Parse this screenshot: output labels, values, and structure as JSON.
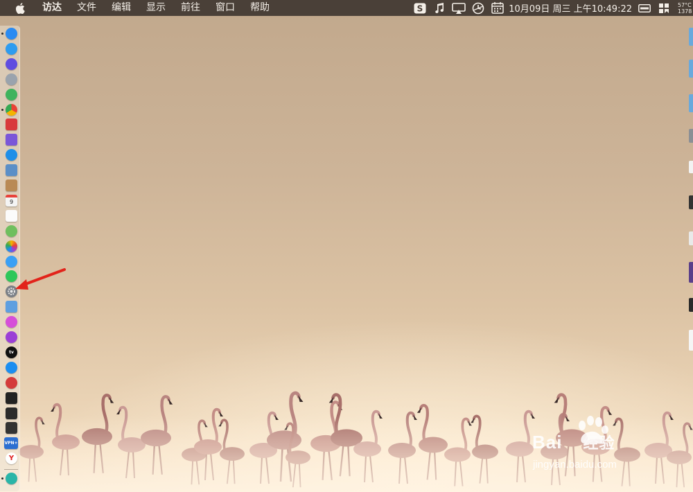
{
  "menubar": {
    "apple_icon": "apple-logo",
    "items": [
      "访达",
      "文件",
      "编辑",
      "显示",
      "前往",
      "窗口",
      "帮助"
    ],
    "status_icons": [
      "sogou-input-icon",
      "music-note-icon",
      "airplay-icon",
      "clock-sync-icon",
      "calendar-icon"
    ],
    "clock": "10月09日 周三 上午10:49:22",
    "right_icons": [
      "battery-toggle-icon",
      "grid-icon"
    ],
    "temps": [
      "57°C",
      "1378"
    ]
  },
  "dock": {
    "apps": [
      {
        "name": "finder",
        "color": "#2a8bf2",
        "running": true
      },
      {
        "name": "safari-compass",
        "color": "#2d9cf0",
        "running": false
      },
      {
        "name": "siri",
        "color": "#5f4de0",
        "running": false
      },
      {
        "name": "launchpad",
        "color": "#9aa3ad",
        "running": false
      },
      {
        "name": "android-studio",
        "color": "#3fb35d",
        "running": false
      },
      {
        "name": "chrome",
        "color": "#e94235",
        "running": true
      },
      {
        "name": "toolbox",
        "color": "#d8393b",
        "running": false
      },
      {
        "name": "purple-app",
        "color": "#7a56d8",
        "running": false
      },
      {
        "name": "safari",
        "color": "#1f8fe8",
        "running": false
      },
      {
        "name": "preview",
        "color": "#5b8fc7",
        "running": false
      },
      {
        "name": "contacts-book",
        "color": "#b98a55",
        "running": false
      },
      {
        "name": "calendar",
        "color": "#f4f4f4",
        "running": false
      },
      {
        "name": "notes",
        "color": "#fbfbfb",
        "running": false
      },
      {
        "name": "maps",
        "color": "#6fbf5e",
        "running": false
      },
      {
        "name": "photos",
        "color": "#f0f0f0",
        "running": false
      },
      {
        "name": "messages",
        "color": "#3aa0f5",
        "running": false
      },
      {
        "name": "wechat",
        "color": "#2ec75a",
        "running": false
      },
      {
        "name": "system-preferences",
        "color": "#7a7f86",
        "running": false
      },
      {
        "name": "downloads-stack",
        "color": "#5e9fe0",
        "running": false
      },
      {
        "name": "itunes",
        "color": "#d64fd9",
        "running": false
      },
      {
        "name": "podcasts",
        "color": "#9b3fd6",
        "running": false
      },
      {
        "name": "apple-tv",
        "color": "#111111",
        "running": false
      },
      {
        "name": "app-store",
        "color": "#1c8ef0",
        "running": false
      },
      {
        "name": "vivaldi",
        "color": "#d43b3b",
        "running": false
      },
      {
        "name": "terminal",
        "color": "#222222",
        "running": false
      },
      {
        "name": "activity-monitor",
        "color": "#2b2b2b",
        "running": false
      },
      {
        "name": "console",
        "color": "#333333",
        "running": false
      },
      {
        "name": "vpn",
        "color": "#2c6fd1",
        "running": false
      },
      {
        "name": "yandex",
        "color": "#e02020",
        "running": false
      },
      {
        "name": "trash-widget",
        "color": "#29b5a8",
        "running": true
      }
    ],
    "calendar_day": "9",
    "vpn_label": "VPN+",
    "tv_label": "tv"
  },
  "watermark": {
    "main": "Bai",
    "main2": "经验",
    "sub": "jingyan.baidu.com"
  },
  "annotation": {
    "color": "#e2231a",
    "points_to": "system-preferences"
  }
}
